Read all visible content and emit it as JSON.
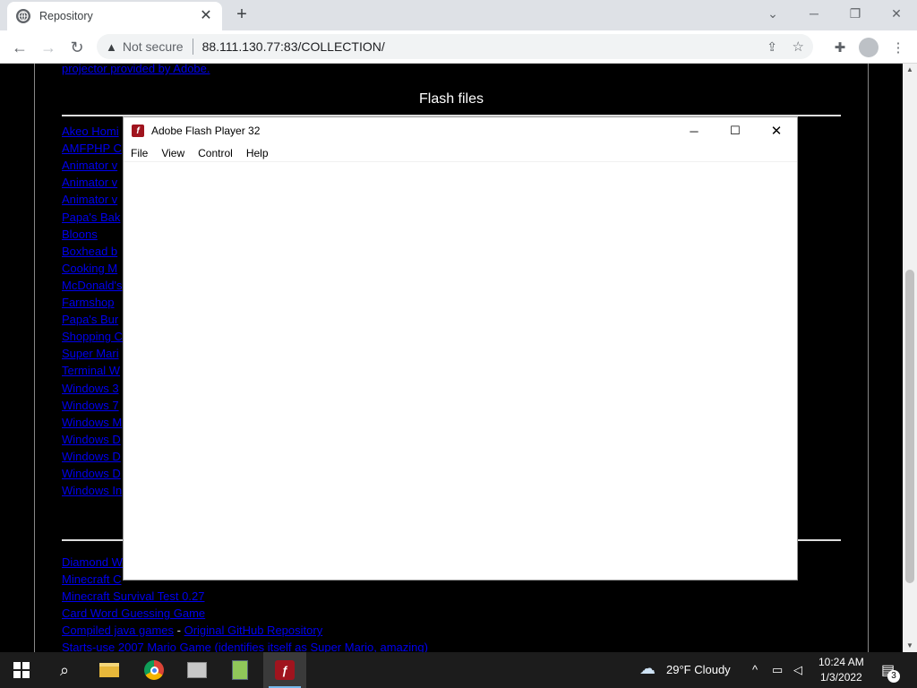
{
  "browser": {
    "tab_title": "Repository",
    "tab_close": "✕",
    "new_tab": "+",
    "security_label": "Not secure",
    "url": "88.111.130.77:83/COLLECTION/"
  },
  "page": {
    "top_link": "projector provided by Adobe.",
    "section_heading": "Flash files",
    "flash_links": [
      "Akeo Homi",
      "AMFPHP C",
      "Animator v",
      "Animator v",
      "Animator v",
      "Papa's Bak",
      "Bloons",
      "Boxhead b",
      "Cooking M",
      "McDonald's",
      "Farmshop",
      "Papa's Bur",
      "Shopping C",
      "Super Mari",
      "Terminal W",
      "Windows 3",
      "Windows 7",
      "Windows M",
      "Windows D",
      "Windows D",
      "Windows D",
      "Windows In"
    ],
    "other_links": [
      "Diamond W",
      "Minecraft C",
      "Minecraft Survival Test 0.27",
      "Card Word Guessing Game"
    ],
    "java_link": "Compiled java games",
    "java_separator": " - ",
    "github_link": "Original GitHub Repository",
    "mario_link": "Starts-use 2007 Mario Game (identifies itself as Super Mario, amazing)"
  },
  "flash_window": {
    "title": "Adobe Flash Player 32",
    "menu": [
      "File",
      "View",
      "Control",
      "Help"
    ],
    "icon_letter": "f"
  },
  "taskbar": {
    "weather": "29°F  Cloudy",
    "time": "10:24 AM",
    "date": "1/3/2022",
    "notification_count": "3"
  }
}
